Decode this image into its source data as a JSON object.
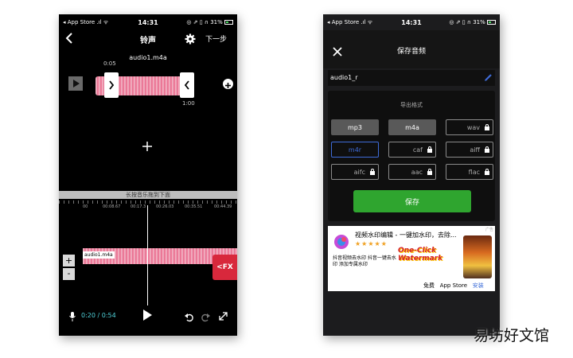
{
  "screen1": {
    "status": {
      "left": "◂ App Store .ıl ᯤ",
      "time": "14:31",
      "right": "◎ ⇗ ▯ ∩ 31%"
    },
    "header": {
      "title": "铃声",
      "next": "下一步"
    },
    "filename": "audio1.m4a",
    "clip": {
      "start": "0:05",
      "end": "1:00"
    },
    "drag_hint": "长按音乐拖到下面",
    "ruler_ticks": [
      "00",
      "00:08.67",
      "00:17.3",
      "00:26.03",
      "00:35.51",
      "00:44.39"
    ],
    "track_label": "audio1.m4a",
    "fx_label": "<FX",
    "time_readout": "0:20 / 0:54",
    "accent": "#e8587e",
    "fx_color": "#d8283c"
  },
  "screen2": {
    "status": {
      "left": "◂ App Store .ıl ᯤ",
      "time": "14:31",
      "right": "◎ ⇗ ▯ ∩ 31%"
    },
    "header": {
      "title": "保存音频"
    },
    "filename_value": "audio1_r",
    "section_title": "导出格式",
    "formats": [
      "mp3",
      "m4a",
      "wav",
      "m4r",
      "caf",
      "aiff",
      "aifc",
      "aac",
      "flac"
    ],
    "save_label": "保存",
    "save_color": "#2fa52f",
    "ad": {
      "badge": "广告",
      "title": "视频水印编辑 - 一键加水印，去除...",
      "stars": "★★★★★",
      "desc": "抖音视频去水印 抖音一键去水印 添加专属水印",
      "brand": "One-Click Watermark",
      "free": "免费",
      "store": "App Store",
      "install": "安装"
    }
  },
  "watermark": "易坊好文馆"
}
